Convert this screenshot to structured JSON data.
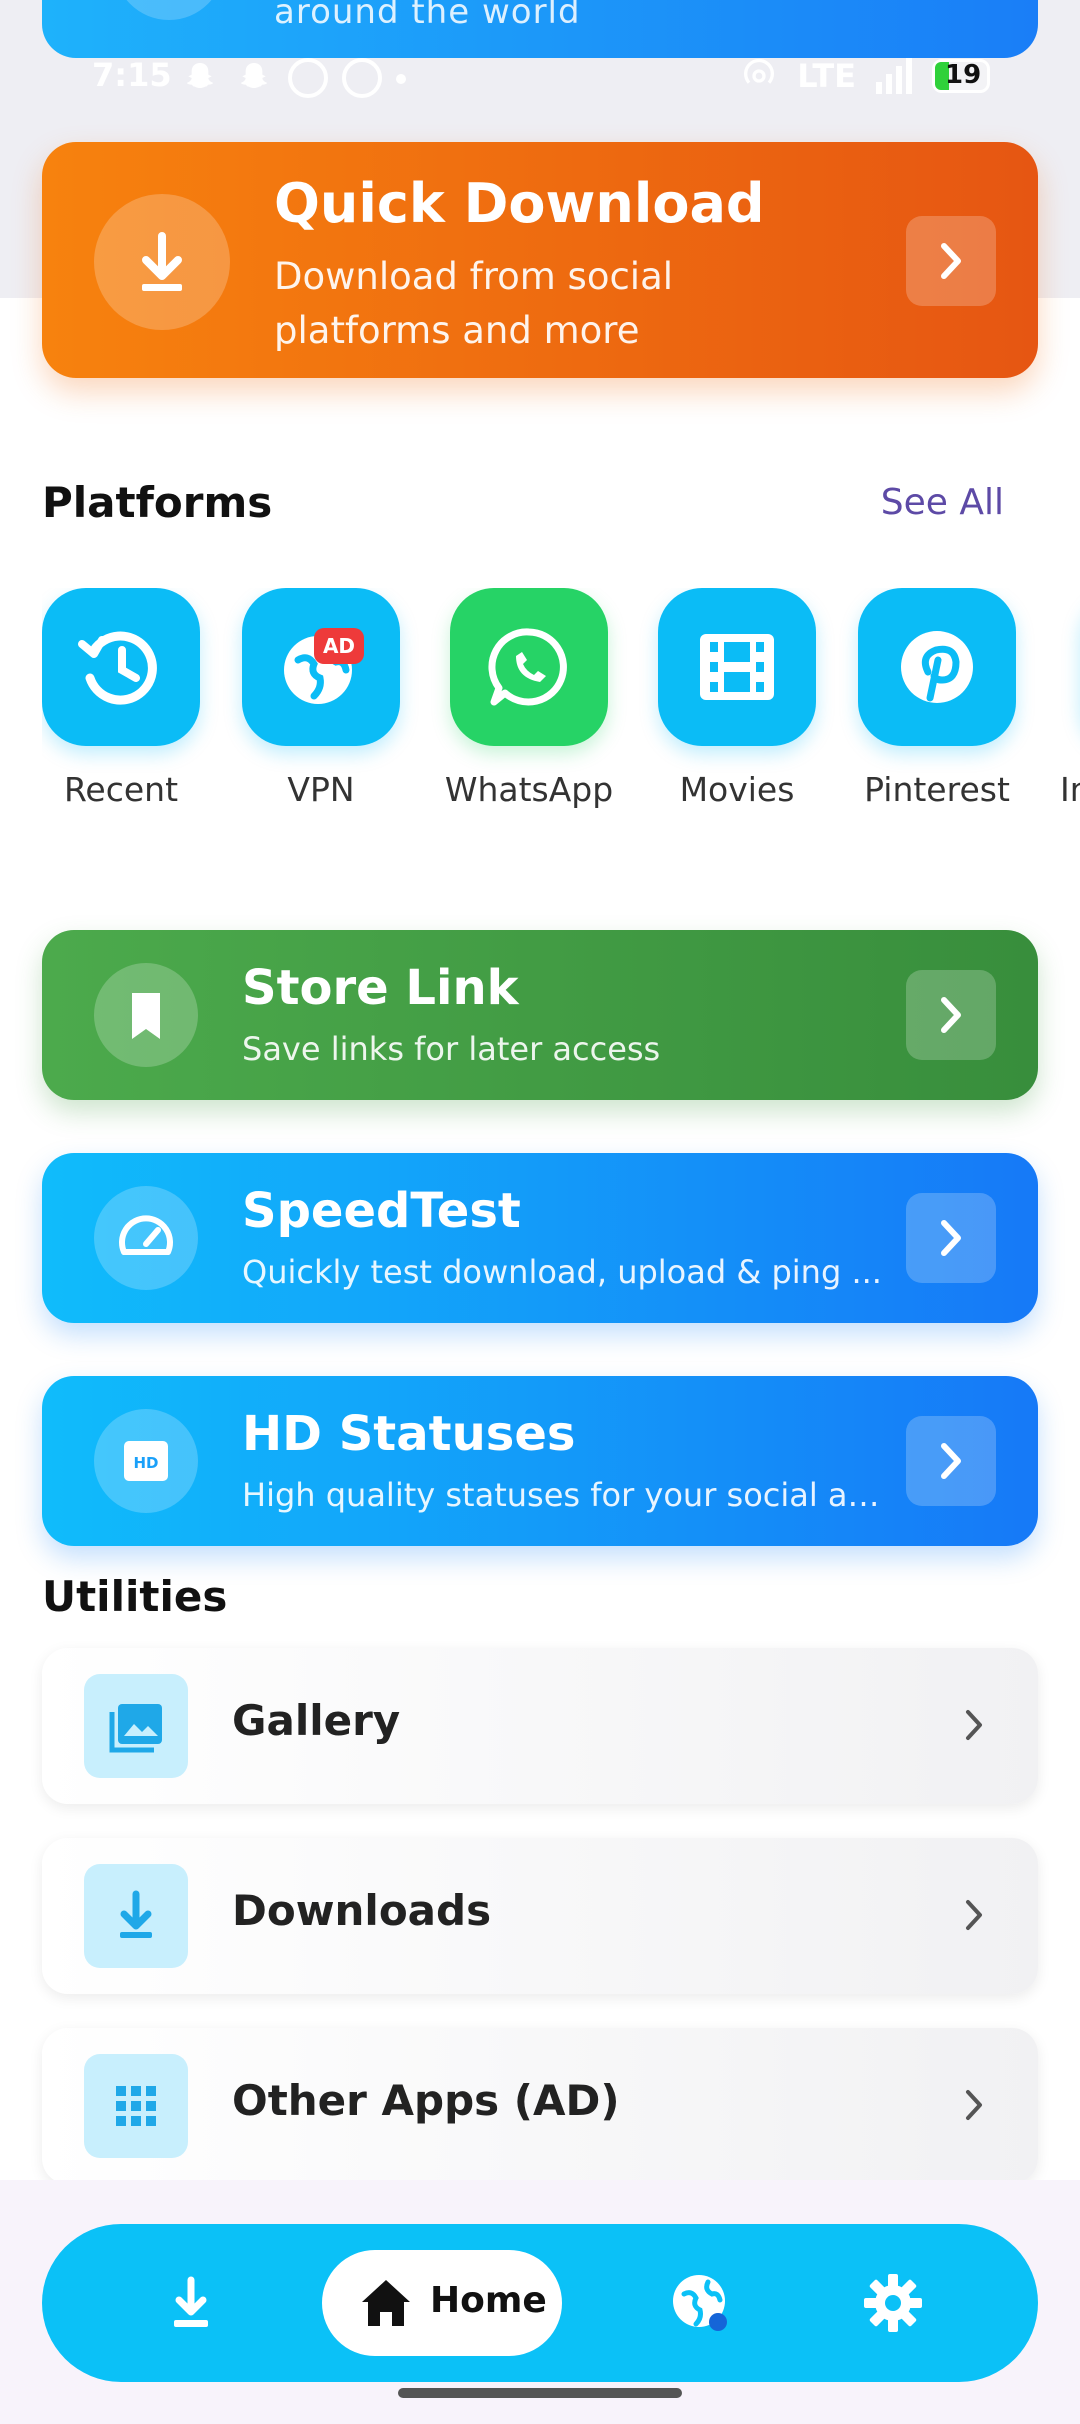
{
  "top_card_peek": {
    "text": "around the world"
  },
  "status_bar": {
    "time": "7:15",
    "network": "LTE",
    "battery": "19"
  },
  "quick_download": {
    "title": "Quick Download",
    "subtitle": "Download from social platforms and more"
  },
  "platforms": {
    "title": "Platforms",
    "see_all": "See All",
    "items": [
      {
        "label": "Recent",
        "icon": "history-icon"
      },
      {
        "label": "VPN",
        "icon": "globe-icon",
        "badge": "AD"
      },
      {
        "label": "WhatsApp",
        "icon": "whatsapp-icon"
      },
      {
        "label": "Movies",
        "icon": "film-icon"
      },
      {
        "label": "Pinterest",
        "icon": "pinterest-icon"
      },
      {
        "label": "In",
        "icon": "instagram-icon"
      }
    ]
  },
  "features": [
    {
      "title": "Store Link",
      "subtitle": "Save links for later access",
      "icon": "bookmark-icon",
      "color": "#43a047"
    },
    {
      "title": "SpeedTest",
      "subtitle": "Quickly test download, upload & ping ...",
      "icon": "speedometer-icon",
      "color": "#1a9cf9"
    },
    {
      "title": "HD Statuses",
      "subtitle": "High quality statuses for your social ap...",
      "icon": "hd-icon",
      "color": "#1a9cf9"
    }
  ],
  "utilities": {
    "title": "Utilities",
    "items": [
      {
        "label": "Gallery",
        "icon": "image-icon"
      },
      {
        "label": "Downloads",
        "icon": "download-icon"
      },
      {
        "label": "Other Apps (AD)",
        "icon": "grid-icon"
      }
    ]
  },
  "bottom_nav": {
    "home_label": "Home",
    "accent": "#0bc1f7"
  }
}
